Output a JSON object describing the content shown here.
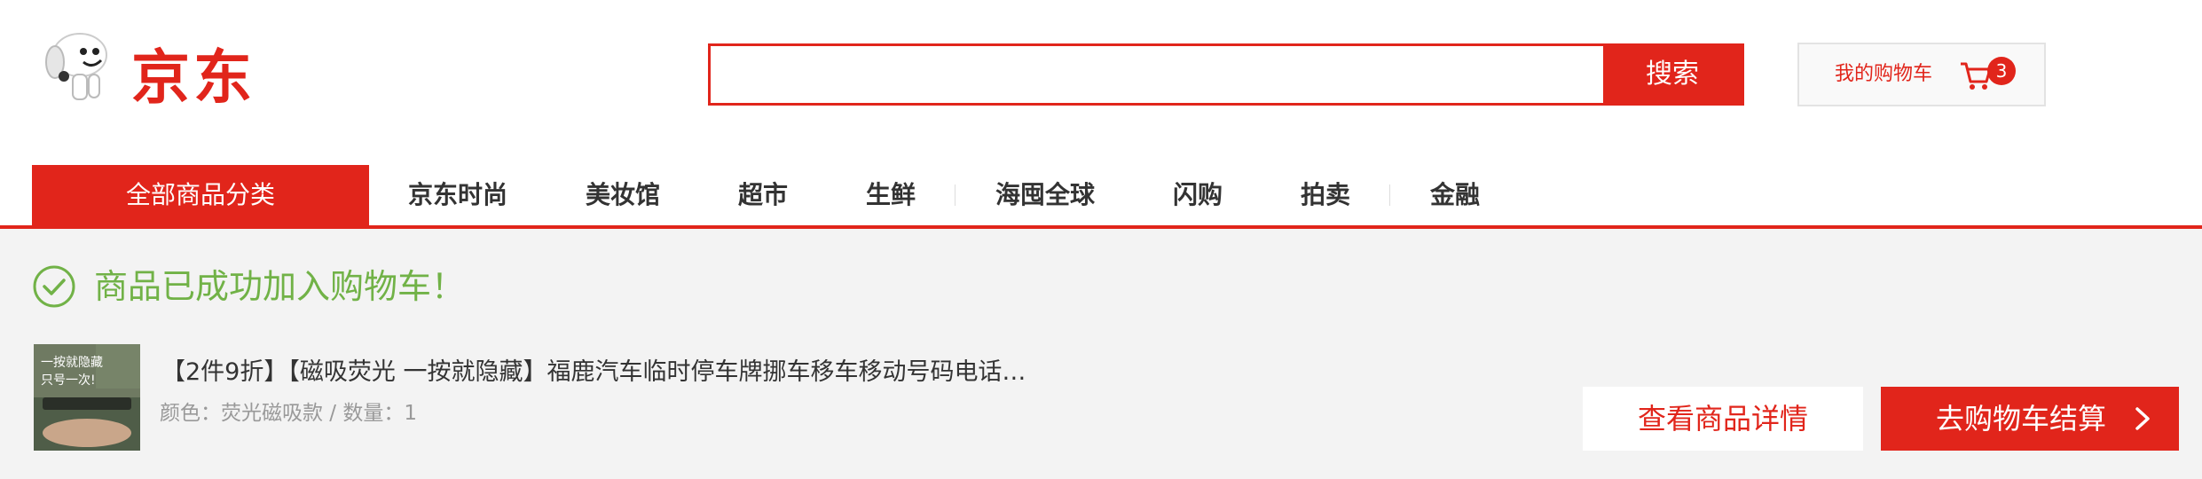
{
  "header": {
    "logo_text": "京东",
    "search": {
      "value": "",
      "placeholder": "",
      "button_label": "搜索"
    },
    "cart": {
      "label": "我的购物车",
      "count": "3"
    }
  },
  "nav": {
    "all_categories": "全部商品分类",
    "items": [
      {
        "label": "京东时尚"
      },
      {
        "label": "美妆馆"
      },
      {
        "label": "超市"
      },
      {
        "label": "生鲜"
      },
      {
        "label": "海囤全球"
      },
      {
        "label": "闪购"
      },
      {
        "label": "拍卖"
      },
      {
        "label": "金融"
      }
    ]
  },
  "success": {
    "message": "商品已成功加入购物车！"
  },
  "product": {
    "title": "【2件9折】【磁吸荧光 一按就隐藏】福鹿汽车临时停车牌挪车移车移动号码电话…",
    "meta": "颜色：荧光磁吸款 / 数量：1",
    "thumb_text": [
      "一按就隐藏",
      "只号一次!"
    ]
  },
  "actions": {
    "detail_label": "查看商品详情",
    "checkout_label": "去购物车结算"
  },
  "colors": {
    "brand_red": "#e1251b",
    "success_green": "#71b247",
    "background": "#f3f3f3"
  }
}
